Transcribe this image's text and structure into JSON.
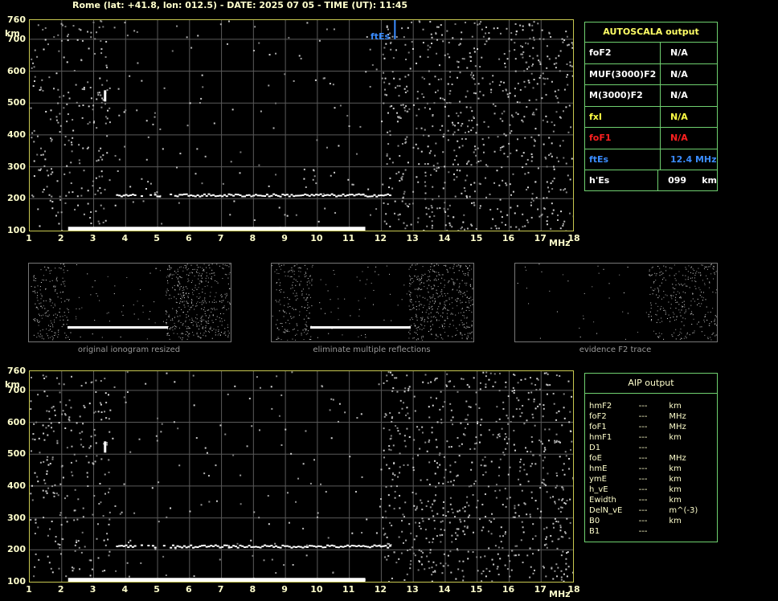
{
  "header": {
    "title": "Rome (lat: +41.8, lon: 012.5) - DATE: 2025 07 05 - TIME (UT): 11:45"
  },
  "ionogram": {
    "y_unit": "km",
    "x_unit": "MHz",
    "y_ticks": [
      "760",
      "700",
      "600",
      "500",
      "400",
      "300",
      "200",
      "100"
    ],
    "x_ticks": [
      "1",
      "2",
      "3",
      "4",
      "5",
      "6",
      "7",
      "8",
      "9",
      "10",
      "11",
      "12",
      "13",
      "14",
      "15",
      "16",
      "17",
      "18"
    ],
    "ftes_marker_label": "ftEs"
  },
  "autoscala": {
    "title": "AUTOSCALA output",
    "rows": [
      {
        "key": "foF2",
        "value": "N/A",
        "color": "#ffffff"
      },
      {
        "key": "MUF(3000)F2",
        "value": "N/A",
        "color": "#ffffff"
      },
      {
        "key": "M(3000)F2",
        "value": "N/A",
        "color": "#ffffff"
      },
      {
        "key": "fxI",
        "value": "N/A",
        "color": "#ffff44"
      },
      {
        "key": "foF1",
        "value": "N/A",
        "color": "#ff2020"
      },
      {
        "key": "ftEs",
        "value": "12.4 MHz",
        "color": "#3a8cff"
      },
      {
        "key": "h'Es",
        "value": "099     km",
        "color": "#ffffff"
      }
    ]
  },
  "thumbnails": [
    {
      "caption": "original ionogram resized"
    },
    {
      "caption": "eliminate multiple reflections"
    },
    {
      "caption": "evidence F2 trace"
    }
  ],
  "aip": {
    "title": "AIP output",
    "rows": [
      {
        "k": "hmF2",
        "v": "---",
        "u": "km"
      },
      {
        "k": "foF2",
        "v": "---",
        "u": "MHz"
      },
      {
        "k": "foF1",
        "v": "---",
        "u": "MHz"
      },
      {
        "k": "hmF1",
        "v": "---",
        "u": "km"
      },
      {
        "k": "D1",
        "v": "---",
        "u": ""
      },
      {
        "k": "foE",
        "v": "---",
        "u": "MHz"
      },
      {
        "k": "hmE",
        "v": "---",
        "u": "km"
      },
      {
        "k": "ymE",
        "v": "---",
        "u": "km"
      },
      {
        "k": "h_vE",
        "v": "---",
        "u": "km"
      },
      {
        "k": "Ewidth",
        "v": "---",
        "u": "km"
      },
      {
        "k": "DelN_vE",
        "v": "---",
        "u": "m^(-3)"
      },
      {
        "k": "B0",
        "v": "---",
        "u": "km"
      },
      {
        "k": "B1",
        "v": "---",
        "u": ""
      }
    ]
  },
  "colors": {
    "axis": "#c8c850",
    "grid": "#5a5a5a",
    "trace": "#ffffff",
    "ftes": "#3a8cff",
    "panel_border": "#6fd06f"
  }
}
